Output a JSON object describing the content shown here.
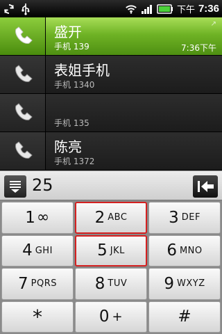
{
  "status_bar": {
    "time": "7:36",
    "ampm": "下午"
  },
  "call_log": [
    {
      "name": "盛开",
      "number": "手机 139",
      "time": "7:36下午"
    },
    {
      "name": "表姐手机",
      "number": "手机 1340",
      "time": ""
    },
    {
      "name": "",
      "number": "手机 135",
      "time": ""
    },
    {
      "name": "陈亮",
      "number": "手机 1372",
      "time": ""
    }
  ],
  "dial_input": {
    "value": "25"
  },
  "keypad": [
    {
      "digit": "1",
      "letters": "∞"
    },
    {
      "digit": "2",
      "letters": "ABC"
    },
    {
      "digit": "3",
      "letters": "DEF"
    },
    {
      "digit": "4",
      "letters": "GHI"
    },
    {
      "digit": "5",
      "letters": "JKL"
    },
    {
      "digit": "6",
      "letters": "MNO"
    },
    {
      "digit": "7",
      "letters": "PQRS"
    },
    {
      "digit": "8",
      "letters": "TUV"
    },
    {
      "digit": "9",
      "letters": "WXYZ"
    },
    {
      "digit": "*",
      "letters": ""
    },
    {
      "digit": "0",
      "letters": "+"
    },
    {
      "digit": "#",
      "letters": ""
    }
  ],
  "colors": {
    "highlight_green": "#6fb325",
    "selected_key_border": "#d42020"
  },
  "icons": {
    "status_left": [
      "sync-icon",
      "usb-icon"
    ],
    "status_right": [
      "wifi-icon",
      "signal-icon",
      "battery-icon"
    ],
    "call_row": "phone-handset-icon",
    "menu": "dialpad-menu-icon",
    "delete": "backspace-icon"
  }
}
